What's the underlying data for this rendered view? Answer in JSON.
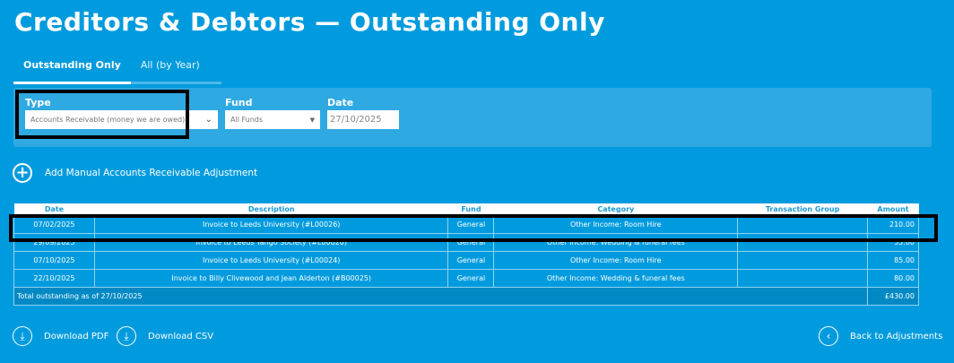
{
  "title": "Creditors & Debtors — Outstanding Only",
  "tabs": [
    {
      "label": "Outstanding Only",
      "active": true
    },
    {
      "label": "All (by Year)",
      "active": false
    }
  ],
  "filters": {
    "type": {
      "label": "Type",
      "value": "Accounts Receivable (money we are owed)"
    },
    "fund": {
      "label": "Fund",
      "value": "All Funds"
    },
    "date": {
      "label": "Date",
      "value": "27/10/2025"
    }
  },
  "add_label": "Add Manual Accounts Receivable Adjustment",
  "table": {
    "headers": [
      "Date",
      "Description",
      "Fund",
      "Category",
      "Transaction Group",
      "Amount"
    ],
    "rows": [
      [
        "07/02/2025",
        "Invoice to Leeds University (#L00026)",
        "General",
        "Other Income: Room Hire",
        "",
        "210.00"
      ],
      [
        "29/09/2025",
        "Invoice to Leeds Tango Society (#L00020)",
        "General",
        "Other Income: Wedding & funeral fees",
        "",
        "55.00"
      ],
      [
        "07/10/2025",
        "Invoice to Leeds University (#L00024)",
        "General",
        "Other Income: Room Hire",
        "",
        "85.00"
      ],
      [
        "22/10/2025",
        "Invoice to Billy Clivewood and Jean Alderton (#B00025)",
        "General",
        "Other Income: Wedding & funeral fees",
        "",
        "80.00"
      ]
    ],
    "total_label": "Total outstanding as of 27/10/2025",
    "total_value": "£430.00"
  },
  "actions": {
    "pdf": "Download PDF",
    "csv": "Download CSV",
    "back": "Back to Adjustments"
  }
}
